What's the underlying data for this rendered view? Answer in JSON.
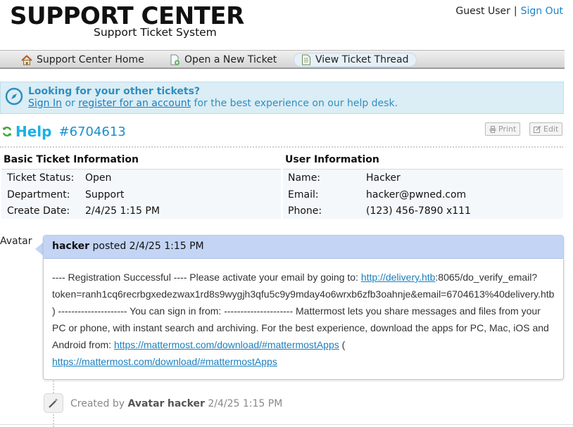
{
  "header": {
    "logo_title": "SUPPORT CENTER",
    "logo_subtitle": "Support Ticket System",
    "guest_label": "Guest User",
    "separator": "|",
    "sign_out": "Sign Out"
  },
  "nav": {
    "items": [
      {
        "label": "Support Center Home",
        "icon": "home-icon"
      },
      {
        "label": "Open a New Ticket",
        "icon": "new-ticket-icon"
      },
      {
        "label": "View Ticket Thread",
        "icon": "ticket-thread-icon"
      }
    ]
  },
  "notice": {
    "title": "Looking for your other tickets?",
    "sign_in": "Sign In",
    "or": "or",
    "register": "register for an account",
    "suffix": "for the best experience on our help desk."
  },
  "ticket": {
    "title": "Help",
    "number": "#6704613",
    "print_label": "Print",
    "edit_label": "Edit"
  },
  "basic_info": {
    "heading": "Basic Ticket Information",
    "rows": [
      {
        "label": "Ticket Status:",
        "value": "Open"
      },
      {
        "label": "Department:",
        "value": "Support"
      },
      {
        "label": "Create Date:",
        "value": "2/4/25 1:15 PM"
      }
    ]
  },
  "user_info": {
    "heading": "User Information",
    "rows": [
      {
        "label": "Name:",
        "value": "Hacker"
      },
      {
        "label": "Email:",
        "value": "hacker@pwned.com"
      },
      {
        "label": "Phone:",
        "value": "(123) 456-7890 x111"
      }
    ]
  },
  "thread": {
    "avatar_label": "Avatar",
    "author": "hacker",
    "posted": "posted 2/4/25 1:15 PM",
    "body_1": "---- Registration Successful ---- Please activate your email by going to: ",
    "link_1": "http://delivery.htb",
    "body_2": ":8065/do_verify_email?token=ranh1cq6recrbgxedezwax1rd8s9wygjh3qfu5c9y9mday4o6wrxb6zfb3oahnje&email=6704613%40delivery.htb ) --------------------- You can sign in from: --------------------- Mattermost lets you share messages and files from your PC or phone, with instant search and archiving. For the best experience, download the apps for PC, Mac, iOS and Android from: ",
    "link_2": "https://mattermost.com/download/#mattermostApps",
    "body_3": " ( ",
    "link_3": "https://mattermost.com/download/#mattermostApps"
  },
  "event": {
    "created_by": "Created by",
    "avatar_label": "Avatar",
    "author": "hacker",
    "time": "2/4/25 1:15 PM"
  }
}
